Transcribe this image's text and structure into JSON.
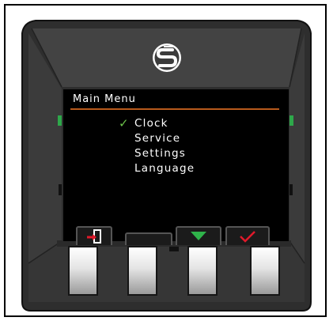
{
  "menu": {
    "title": "Main Menu",
    "items": [
      {
        "label": "Clock",
        "selected": true
      },
      {
        "label": "Service",
        "selected": false
      },
      {
        "label": "Settings",
        "selected": false
      },
      {
        "label": "Language",
        "selected": false
      }
    ],
    "selection_mark": "✓"
  },
  "softkeys": [
    {
      "icon": "exit-icon"
    },
    {
      "icon": "blank"
    },
    {
      "icon": "down-arrow-icon"
    },
    {
      "icon": "checkmark-icon"
    }
  ],
  "colors": {
    "bezel": "#3a3a3a",
    "screen": "#000000",
    "title_rule": "#b85a1c",
    "led": "#2ea84a",
    "down_arrow": "#2fb34a",
    "check": "#e0192a",
    "exit_arrow": "#e0192a"
  },
  "logo": {
    "icon": "brand-logo-icon"
  }
}
